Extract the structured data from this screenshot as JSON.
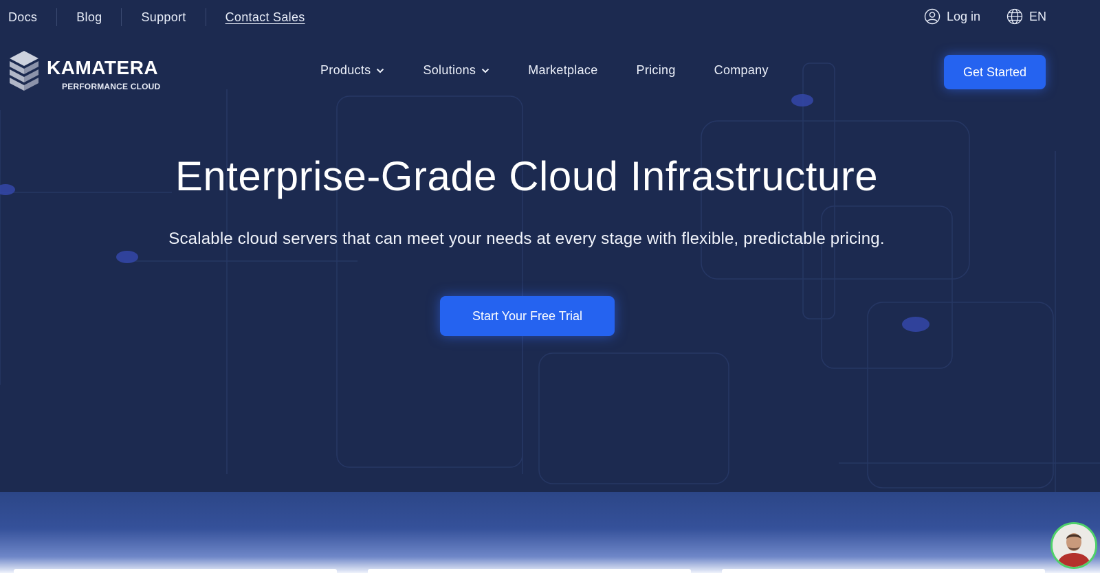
{
  "topbar": {
    "links": [
      {
        "label": "Docs"
      },
      {
        "label": "Blog"
      },
      {
        "label": "Support"
      },
      {
        "label": "Contact Sales"
      }
    ],
    "login_label": "Log in",
    "language_label": "EN"
  },
  "brand": {
    "name": "KAMATERA",
    "tagline": "PERFORMANCE CLOUD"
  },
  "nav": {
    "items": [
      {
        "label": "Products",
        "has_dropdown": true
      },
      {
        "label": "Solutions",
        "has_dropdown": true
      },
      {
        "label": "Marketplace",
        "has_dropdown": false
      },
      {
        "label": "Pricing",
        "has_dropdown": false
      },
      {
        "label": "Company",
        "has_dropdown": false
      }
    ],
    "cta_label": "Get Started"
  },
  "hero": {
    "title": "Enterprise-Grade Cloud Infrastructure",
    "subtitle": "Scalable cloud servers that can meet your needs at every stage with flexible, predictable pricing.",
    "cta_label": "Start Your Free Trial"
  },
  "colors": {
    "background": "#1c2a50",
    "accent": "#2563f0",
    "chat_ring": "#4fd06a"
  },
  "icons": {
    "login": "user-circle-icon",
    "language": "globe-icon",
    "dropdown": "chevron-down-icon",
    "chat": "chat-avatar"
  }
}
